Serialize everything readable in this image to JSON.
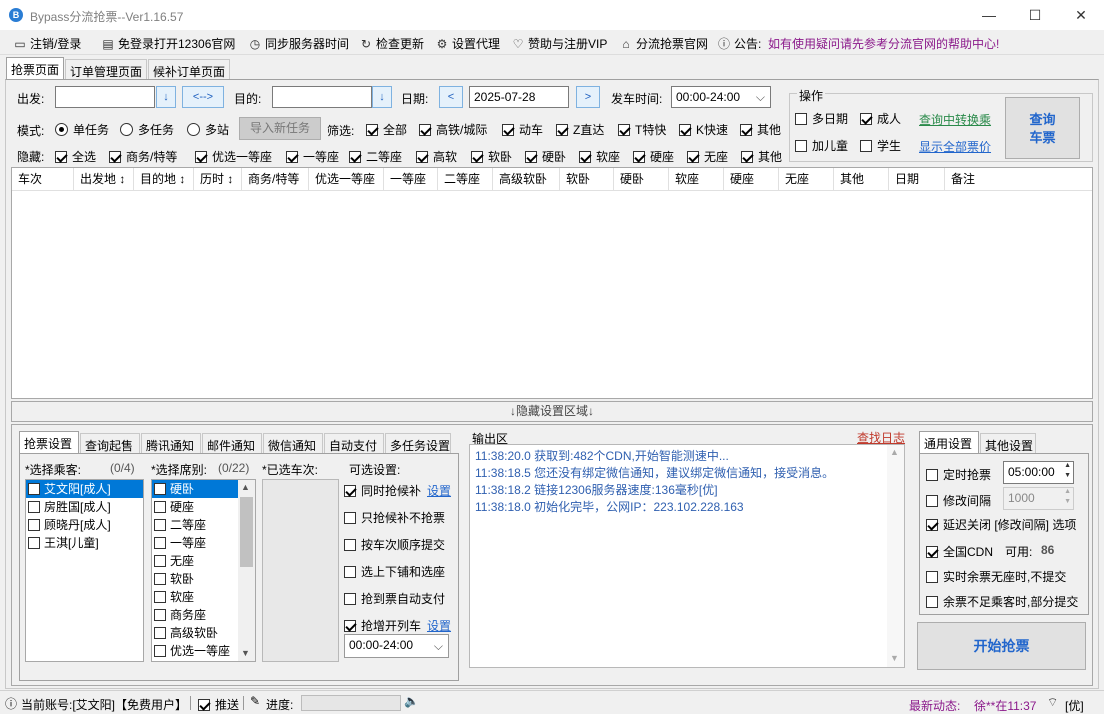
{
  "window": {
    "title": "Bypass分流抢票--Ver1.16.57",
    "app_icon_letter": "B",
    "min": "—",
    "max": "☐",
    "close": "✕"
  },
  "menu": {
    "items": [
      {
        "icon": "▭",
        "label": "注销/登录"
      },
      {
        "icon": "▤",
        "label": "免登录打开12306官网"
      },
      {
        "icon": "◷",
        "label": "同步服务器时间"
      },
      {
        "icon": "↻",
        "label": "检查更新"
      },
      {
        "icon": "⚙",
        "label": "设置代理"
      },
      {
        "icon": "♡",
        "label": "赞助与注册VIP"
      },
      {
        "icon": "⌂",
        "label": "分流抢票官网"
      },
      {
        "icon": "ⓘ",
        "label": "公告:"
      }
    ],
    "notice": "如有使用疑问请先参考分流官网的帮助中心!"
  },
  "main_tabs": [
    "抢票页面",
    "订单管理页面",
    "候补订单页面"
  ],
  "query": {
    "from_label": "出发:",
    "from_value": "",
    "swap": "<-->",
    "dropdown_arrow": "↓",
    "to_label": "目的:",
    "to_value": "",
    "date_label": "日期:",
    "date_prev": "<",
    "date_value": "2025-07-28",
    "date_next": ">",
    "time_label": "发车时间:",
    "time_value": "00:00-24:00",
    "mode_label": "模式:",
    "modes": [
      "单任务",
      "多任务",
      "多站"
    ],
    "import_button": "导入新任务",
    "filter_label": "筛选:",
    "filters": [
      "全部",
      "高铁/城际",
      "动车",
      "Z直达",
      "T特快",
      "K快速",
      "其他"
    ],
    "hide_label": "隐藏:",
    "hides": [
      "全选",
      "商务/特等",
      "优选一等座",
      "一等座",
      "二等座",
      "高软",
      "软卧",
      "硬卧",
      "软座",
      "硬座",
      "无座",
      "其他"
    ]
  },
  "ops": {
    "title": "操作",
    "multi_date": "多日期",
    "adult": "成人",
    "add_child": "加儿童",
    "student": "学生",
    "transfer_link": "查询中转换乘",
    "show_prices_link": "显示全部票价",
    "query_button": "查询\n车票"
  },
  "table": {
    "headers": [
      "车次",
      "出发地 ↕",
      "目的地 ↕",
      "历时 ↕",
      "商务/特等",
      "优选一等座",
      "一等座",
      "二等座",
      "高级软卧",
      "软卧",
      "硬卧",
      "软座",
      "硬座",
      "无座",
      "其他",
      "日期",
      "备注"
    ]
  },
  "hide_settings": "↓隐藏设置区域↓",
  "settings_tabs": [
    "抢票设置",
    "查询起售",
    "腾讯通知",
    "邮件通知",
    "微信通知",
    "自动支付",
    "多任务设置"
  ],
  "passengers": {
    "title": "*选择乘客:",
    "count": "(0/4)",
    "items": [
      "艾文阳[成人]",
      "房胜国[成人]",
      "顾晓丹[成人]",
      "王淇[儿童]"
    ]
  },
  "seats": {
    "title": "*选择席别:",
    "count": "(0/22)",
    "items": [
      "硬卧",
      "硬座",
      "二等座",
      "一等座",
      "无座",
      "软卧",
      "软座",
      "商务座",
      "高级软卧",
      "优选一等座"
    ]
  },
  "trains": {
    "title": "*已选车次:"
  },
  "options": {
    "title": "可选设置:",
    "set_link": "设置",
    "items": [
      {
        "label": "同时抢候补",
        "checked": true,
        "link": true
      },
      {
        "label": "只抢候补不抢票",
        "checked": false,
        "link": false
      },
      {
        "label": "按车次顺序提交",
        "checked": false,
        "link": false
      },
      {
        "label": "选上下铺和选座",
        "checked": false,
        "link": false
      },
      {
        "label": "抢到票自动支付",
        "checked": false,
        "link": false
      },
      {
        "label": "抢增开列车",
        "checked": true,
        "link": true
      }
    ],
    "time_value": "00:00-24:00"
  },
  "output": {
    "title": "输出区",
    "find_log": "查找日志",
    "lines": [
      "11:38:20.0   获取到:482个CDN,开始智能测速中...",
      "11:38:18.5   您还没有绑定微信通知，建议绑定微信通知，接受消息。",
      "11:38:18.2   链接12306服务器速度:136毫秒[优]",
      "11:38:18.0   初始化完毕，公网IP：223.102.228.163"
    ]
  },
  "general": {
    "tabs": [
      "通用设置",
      "其他设置"
    ],
    "timed_label": "定时抢票",
    "timed_value": "05:00:00",
    "interval_label": "修改间隔",
    "interval_value": "1000",
    "delay_label": "延迟关闭 [修改间隔] 选项",
    "cdn_label": "全国CDN",
    "cdn_available_label": "可用:",
    "cdn_available": "86",
    "no_seat_label": "实时余票无座时,不提交",
    "partial_label": "余票不足乘客时,部分提交",
    "start_button": "开始抢票"
  },
  "status": {
    "account": "当前账号:[艾文阳]【免费用户】",
    "push": "推送",
    "progress_label": "进度:",
    "progress": 0,
    "latest_label": "最新动态:",
    "latest": "徐**在11:37",
    "quality": "[优]"
  },
  "colors": {
    "accent": "#2266cc",
    "link_red": "#c0392b",
    "purple": "#8b1a8b",
    "selection": "#0078d7",
    "log_text": "#3060b0"
  }
}
